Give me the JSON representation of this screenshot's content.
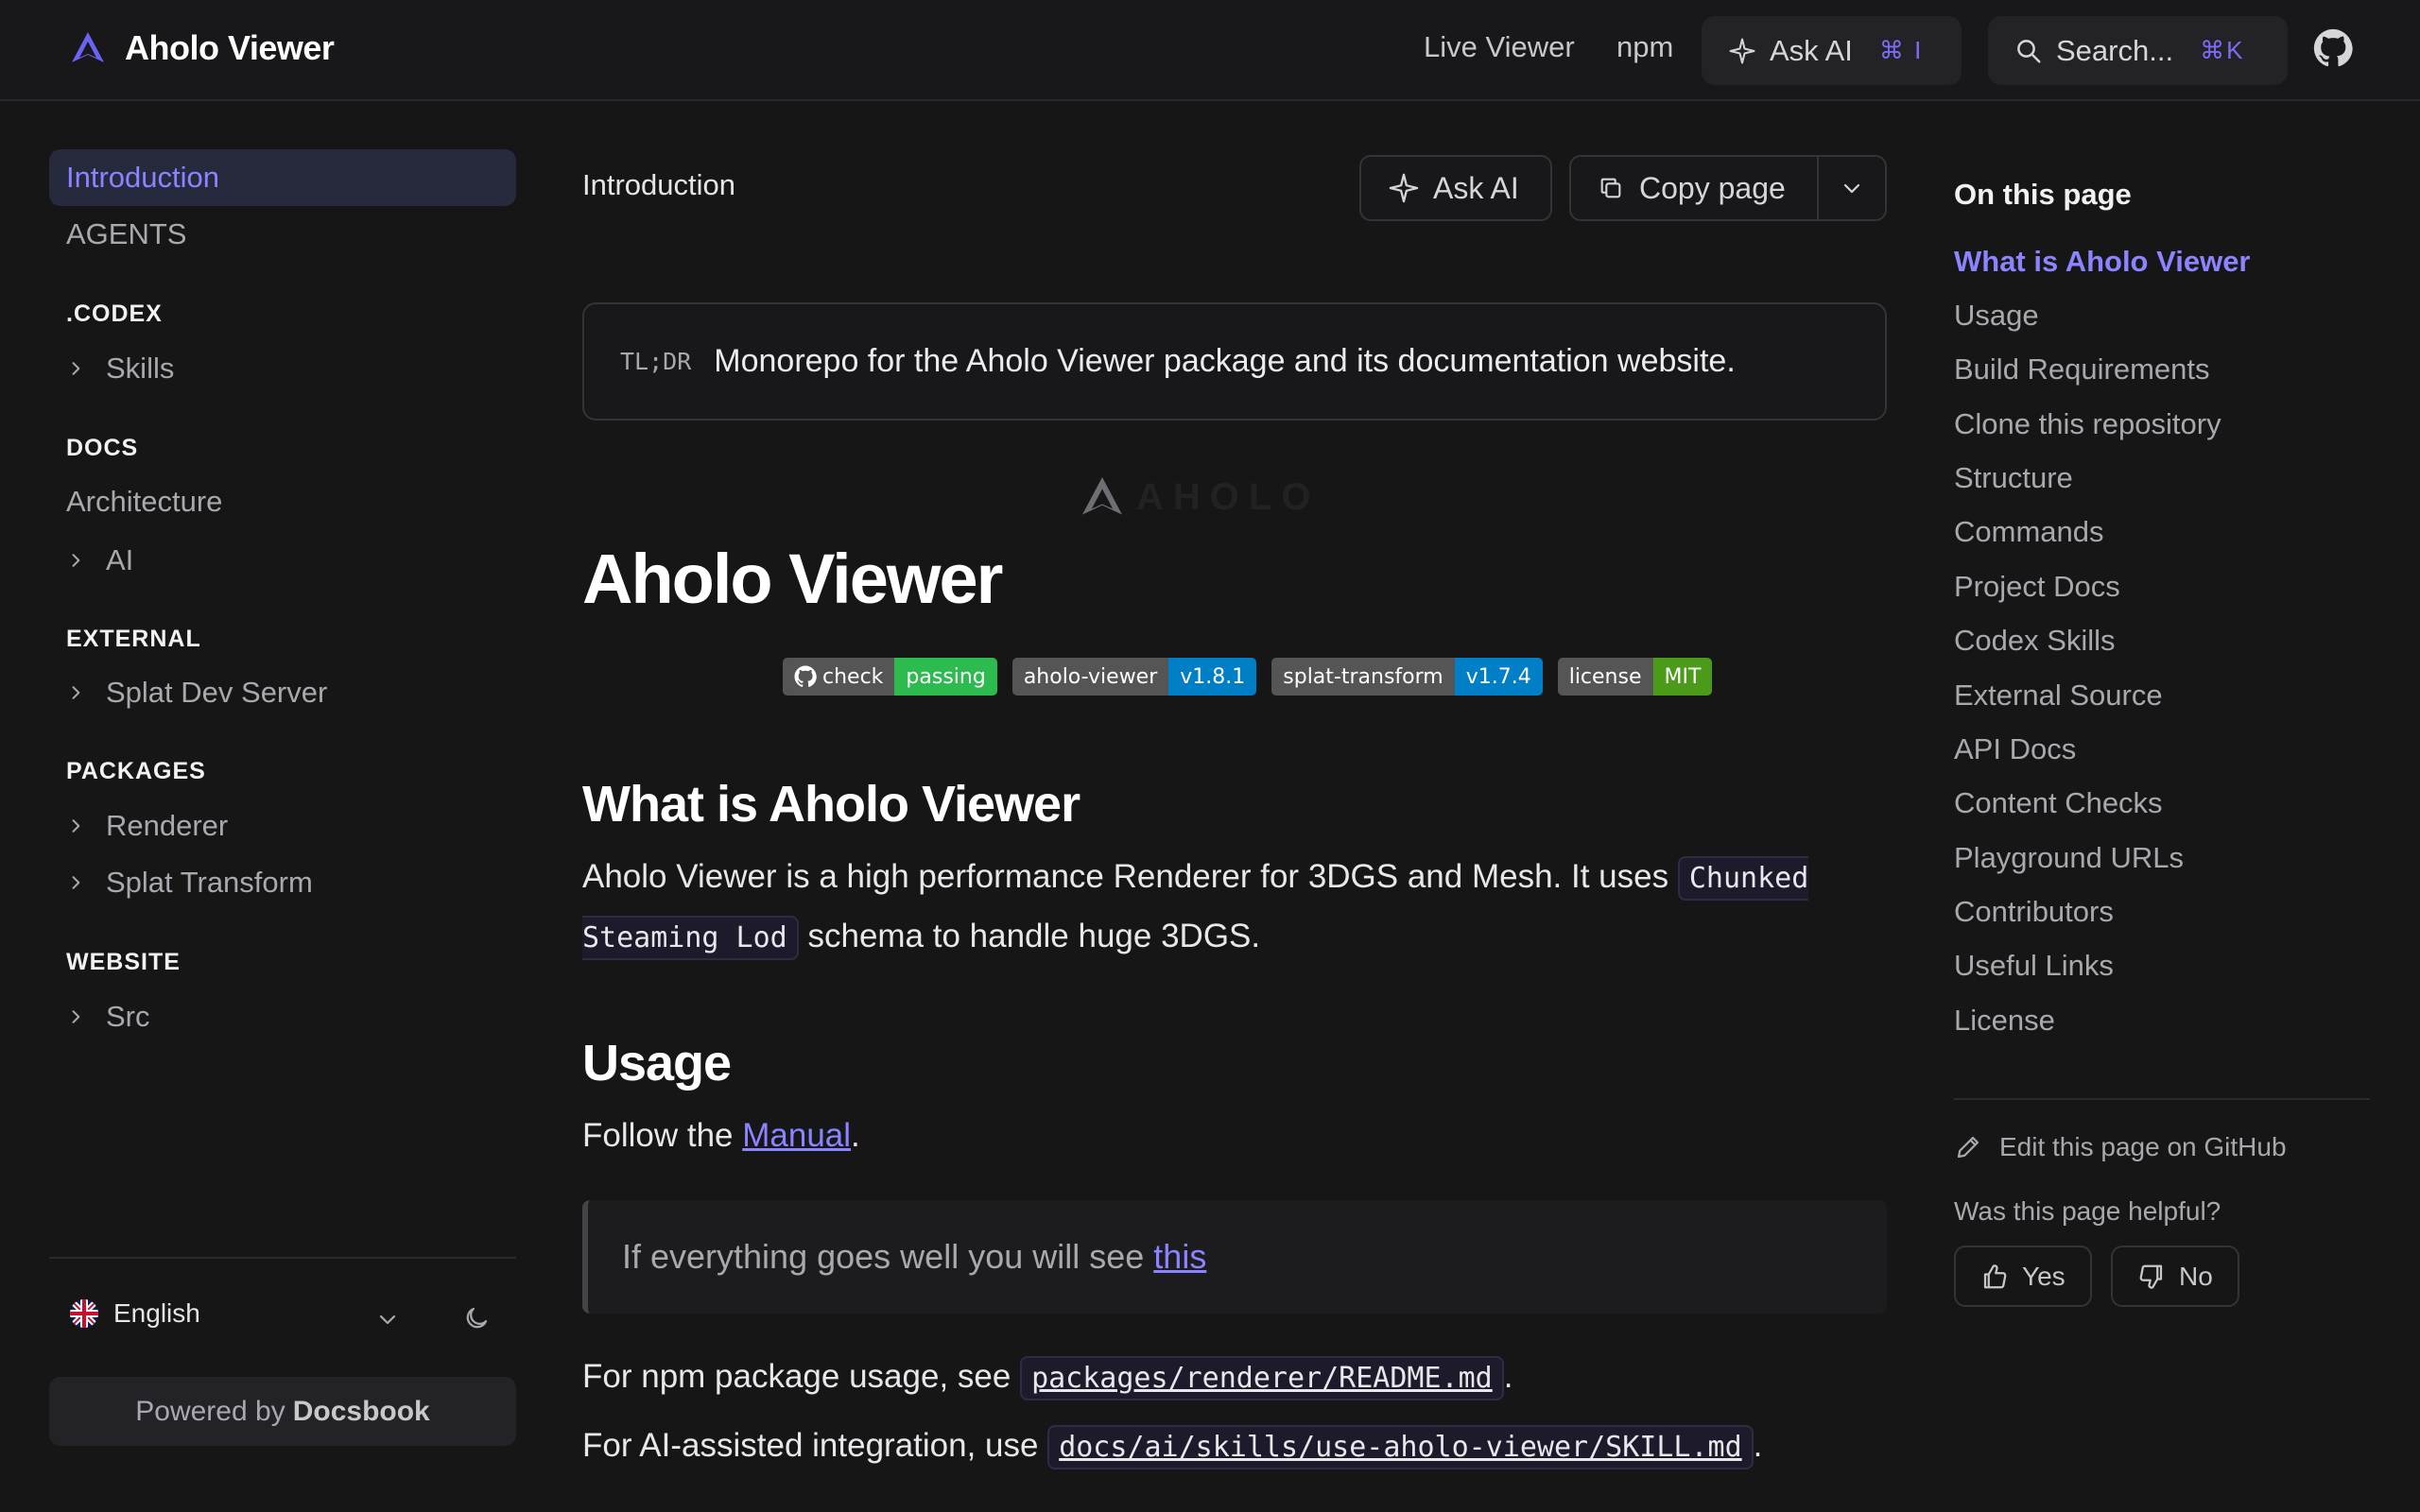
{
  "header": {
    "brand": "Aholo Viewer",
    "links": [
      "Live Viewer",
      "npm"
    ],
    "ask_ai_label": "Ask AI",
    "ask_ai_shortcut": "⌘ I",
    "search_placeholder": "Search...",
    "search_shortcut": "⌘K"
  },
  "sidebar": {
    "items": [
      {
        "label": "Introduction",
        "active": true
      },
      {
        "label": "AGENTS"
      }
    ],
    "sections": [
      {
        "title": ".CODEX",
        "items": [
          "Skills"
        ]
      },
      {
        "title": "DOCS",
        "items": [
          "Architecture",
          "AI"
        ]
      },
      {
        "title": "EXTERNAL",
        "items": [
          "Splat Dev Server"
        ]
      },
      {
        "title": "PACKAGES",
        "items": [
          "Renderer",
          "Splat Transform"
        ]
      },
      {
        "title": "WEBSITE",
        "items": [
          "Src"
        ]
      }
    ],
    "language": "English",
    "powered_prefix": "Powered by",
    "powered_brand": "Docsbook"
  },
  "main": {
    "breadcrumb": "Introduction",
    "ask_ai_label": "Ask AI",
    "copy_page_label": "Copy page",
    "tldr_tag": "TL;DR",
    "tldr_text": "Monorepo for the Aholo Viewer package and its documentation website.",
    "logo_text": "AHOLO",
    "title": "Aholo Viewer",
    "badges": [
      {
        "left": "check",
        "right": "passing",
        "color": "#2dba4e"
      },
      {
        "left": "aholo-viewer",
        "right": "v1.8.1",
        "color": "#007ec6"
      },
      {
        "left": "splat-transform",
        "right": "v1.7.4",
        "color": "#007ec6"
      },
      {
        "left": "license",
        "right": "MIT",
        "color": "#4c9a1a"
      }
    ],
    "what_heading": "What is Aholo Viewer",
    "what_text_1": "Aholo Viewer is a high performance Renderer for 3DGS and Mesh. It uses ",
    "what_code": "Chunked Steaming Lod",
    "what_text_2": " schema to handle huge 3DGS.",
    "usage_heading": "Usage",
    "usage_text": "Follow the ",
    "usage_link": "Manual",
    "usage_end": ".",
    "quote_text": "If everything goes well you will see ",
    "quote_link": "this",
    "npm_text": "For npm package usage, see ",
    "npm_code": "packages/renderer/README.md",
    "ai_text": "For AI-assisted integration, use ",
    "ai_code": "docs/ai/skills/use-aholo-viewer/SKILL.md",
    "period": "."
  },
  "toc": {
    "title": "On this page",
    "items": [
      "What is Aholo Viewer",
      "Usage",
      "Build Requirements",
      "Clone this repository",
      "Structure",
      "Commands",
      "Project Docs",
      "Codex Skills",
      "External Source",
      "API Docs",
      "Content Checks",
      "Playground URLs",
      "Contributors",
      "Useful Links",
      "License"
    ],
    "edit_label": "Edit this page on GitHub",
    "helpful_label": "Was this page helpful?",
    "yes_label": "Yes",
    "no_label": "No"
  },
  "colors": {
    "accent": "#8b83ff",
    "background": "#161616"
  }
}
